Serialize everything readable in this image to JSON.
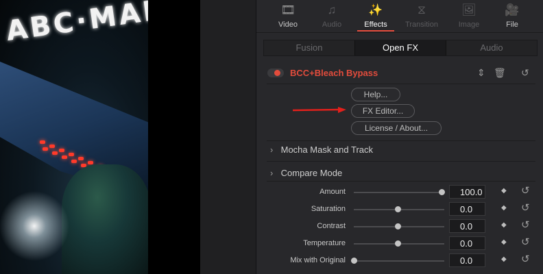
{
  "viewer": {
    "sign_text": "ABC·MAR"
  },
  "tabs": [
    {
      "id": "video",
      "label": "Video",
      "icon": "film-icon",
      "glyph": "🎞",
      "state": "normal"
    },
    {
      "id": "audio",
      "label": "Audio",
      "icon": "music-note-icon",
      "glyph": "♫",
      "state": "dim"
    },
    {
      "id": "effects",
      "label": "Effects",
      "icon": "magic-wand-icon",
      "glyph": "✨",
      "state": "active"
    },
    {
      "id": "transition",
      "label": "Transition",
      "icon": "transition-icon",
      "glyph": "⧖",
      "state": "dim"
    },
    {
      "id": "image",
      "label": "Image",
      "icon": "image-icon",
      "glyph": "🖼",
      "state": "dim"
    },
    {
      "id": "file",
      "label": "File",
      "icon": "file-camera-icon",
      "glyph": "🎥",
      "state": "normal"
    }
  ],
  "subtabs": [
    {
      "label": "Fusion",
      "active": false
    },
    {
      "label": "Open FX",
      "active": true
    },
    {
      "label": "Audio",
      "active": false
    }
  ],
  "effect": {
    "title": "BCC+Bleach Bypass",
    "enabled": true,
    "accent_color": "#e34c3c",
    "buttons": {
      "help": "Help...",
      "fx_editor": "FX Editor...",
      "license": "License / About..."
    }
  },
  "sections": {
    "mocha": "Mocha Mask and Track",
    "compare": "Compare Mode"
  },
  "params": [
    {
      "label": "Amount",
      "value": "100.0",
      "level": 1.0
    },
    {
      "label": "Saturation",
      "value": "0.0",
      "level": 0.5
    },
    {
      "label": "Contrast",
      "value": "0.0",
      "level": 0.5
    },
    {
      "label": "Temperature",
      "value": "0.0",
      "level": 0.5
    },
    {
      "label": "Mix with Original",
      "value": "0.0",
      "level": 0.0
    }
  ],
  "glyphs": {
    "chevron": "›",
    "keyframe": "◆",
    "reset": "↺",
    "updown": "⇕",
    "trash": "🗑"
  }
}
